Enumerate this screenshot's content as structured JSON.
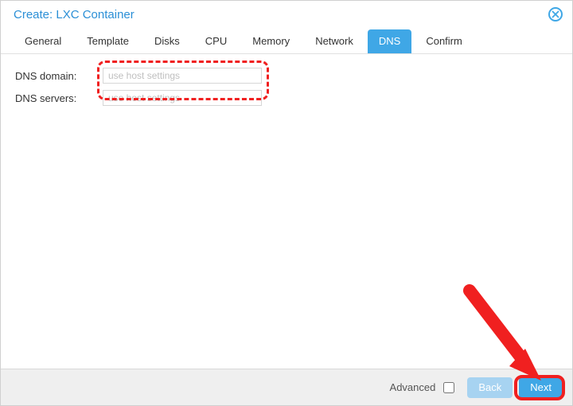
{
  "window": {
    "title": "Create: LXC Container"
  },
  "tabs": {
    "items": [
      {
        "label": "General"
      },
      {
        "label": "Template"
      },
      {
        "label": "Disks"
      },
      {
        "label": "CPU"
      },
      {
        "label": "Memory"
      },
      {
        "label": "Network"
      },
      {
        "label": "DNS"
      },
      {
        "label": "Confirm"
      }
    ],
    "active_index": 6
  },
  "form": {
    "dns_domain": {
      "label": "DNS domain:",
      "value": "",
      "placeholder": "use host settings"
    },
    "dns_servers": {
      "label": "DNS servers:",
      "value": "",
      "placeholder": "use host settings"
    }
  },
  "footer": {
    "advanced_label": "Advanced",
    "advanced_checked": false,
    "back_label": "Back",
    "next_label": "Next"
  },
  "annotations": {
    "highlight_inputs": true,
    "highlight_next": true,
    "arrow_to_next": true
  }
}
